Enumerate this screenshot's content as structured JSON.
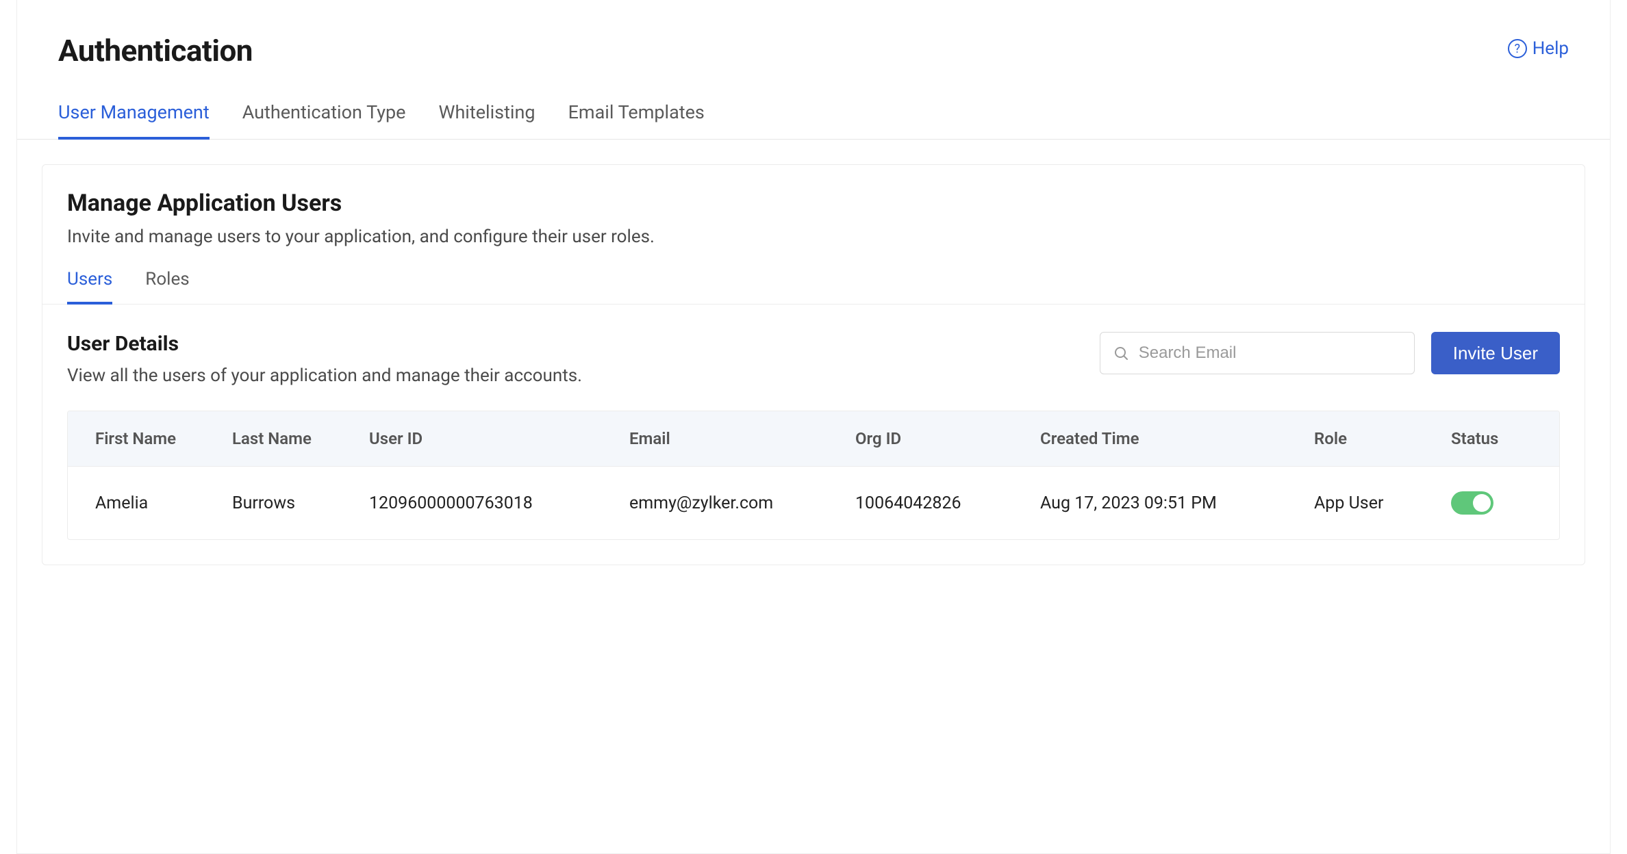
{
  "page": {
    "title": "Authentication",
    "help_label": "Help"
  },
  "top_tabs": [
    {
      "label": "User Management",
      "active": true
    },
    {
      "label": "Authentication Type",
      "active": false
    },
    {
      "label": "Whitelisting",
      "active": false
    },
    {
      "label": "Email Templates",
      "active": false
    }
  ],
  "section": {
    "title": "Manage Application Users",
    "subtitle": "Invite and manage users to your application, and configure their user roles."
  },
  "sub_tabs": [
    {
      "label": "Users",
      "active": true
    },
    {
      "label": "Roles",
      "active": false
    }
  ],
  "details": {
    "title": "User Details",
    "subtitle": "View all the users of your application and manage their accounts.",
    "search_placeholder": "Search Email",
    "invite_label": "Invite User"
  },
  "table": {
    "columns": [
      "First Name",
      "Last Name",
      "User ID",
      "Email",
      "Org ID",
      "Created Time",
      "Role",
      "Status"
    ],
    "rows": [
      {
        "first_name": "Amelia",
        "last_name": "Burrows",
        "user_id": "12096000000763018",
        "email": "emmy@zylker.com",
        "org_id": "10064042826",
        "created_time": "Aug 17, 2023 09:51 PM",
        "role": "App User",
        "status_on": true
      }
    ]
  }
}
